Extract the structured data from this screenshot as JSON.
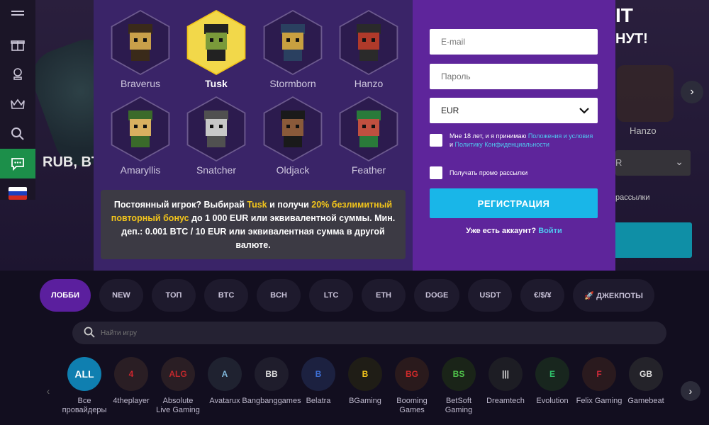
{
  "background": {
    "hero_text": "RUB, BT",
    "right_title_1": "IT",
    "right_title_2": "НУТ!",
    "right_avatar_label": "Hanzo",
    "right_select_value": "R",
    "right_promo_text": "рассылки"
  },
  "side_nav": {
    "items": [
      "menu-icon",
      "gift-icon",
      "trophy-icon",
      "crown-icon",
      "search-icon",
      "chat-icon",
      "flag-ru-icon"
    ]
  },
  "modal": {
    "characters": [
      {
        "name": "Braverus",
        "selected": false
      },
      {
        "name": "Tusk",
        "selected": true
      },
      {
        "name": "Stormborn",
        "selected": false
      },
      {
        "name": "Hanzo",
        "selected": false
      },
      {
        "name": "Amaryllis",
        "selected": false
      },
      {
        "name": "Snatcher",
        "selected": false
      },
      {
        "name": "Oldjack",
        "selected": false
      },
      {
        "name": "Feather",
        "selected": false
      }
    ],
    "promo": {
      "part1": "Постоянный игрок? Выбирай ",
      "highlight_name": "Tusk",
      "part2": " и получи ",
      "highlight_bonus": "20% безлимитный повторный бонус",
      "part3": " до 1 000 EUR или эквивалентной суммы. Мин. деп.: 0.001 BTC / 10 EUR или эквивалентная сумма в другой валюте."
    },
    "form": {
      "email_placeholder": "E-mail",
      "password_placeholder": "Пароль",
      "currency_value": "EUR",
      "terms_text_1": "Мне 18 лет, и я принимаю ",
      "terms_link_1": "Положения и условия",
      "terms_text_2": " и ",
      "terms_link_2": "Политику Конфиденциальности",
      "promo_checkbox_text": "Получать промо рассылки",
      "register_label": "РЕГИСТРАЦИЯ",
      "has_account_text": "Уже есть аккаунт? ",
      "login_link": "Войти"
    }
  },
  "categories": [
    {
      "label": "ЛОББИ",
      "active": true
    },
    {
      "label": "NEW",
      "active": false
    },
    {
      "label": "ТОП",
      "active": false
    },
    {
      "label": "BTC",
      "active": false
    },
    {
      "label": "BCH",
      "active": false
    },
    {
      "label": "LTC",
      "active": false
    },
    {
      "label": "ETH",
      "active": false
    },
    {
      "label": "DOGE",
      "active": false
    },
    {
      "label": "USDT",
      "active": false
    },
    {
      "label": "€/$/¥",
      "active": false
    },
    {
      "label": "🚀 ДЖЕКПОТЫ",
      "active": false
    }
  ],
  "search": {
    "placeholder": "Найти игру"
  },
  "providers": [
    {
      "name": "Все провайдеры",
      "logo": "ALL"
    },
    {
      "name": "4theplayer",
      "logo": "4"
    },
    {
      "name": "Absolute Live Gaming",
      "logo": "ALG"
    },
    {
      "name": "Avatarux",
      "logo": "A"
    },
    {
      "name": "Bangbanggames",
      "logo": "BB"
    },
    {
      "name": "Belatra",
      "logo": "B"
    },
    {
      "name": "BGaming",
      "logo": "B"
    },
    {
      "name": "Booming Games",
      "logo": "BG"
    },
    {
      "name": "BetSoft Gaming",
      "logo": "BS"
    },
    {
      "name": "Dreamtech",
      "logo": "|||"
    },
    {
      "name": "Evolution",
      "logo": "E"
    },
    {
      "name": "Felix Gaming",
      "logo": "F"
    },
    {
      "name": "Gamebeat",
      "logo": "GB"
    }
  ],
  "colors": {
    "accent_blue": "#19b6e8",
    "accent_purple": "#5e259b",
    "highlight_yellow": "#f2c41b",
    "active_green": "#1c8f4a"
  }
}
